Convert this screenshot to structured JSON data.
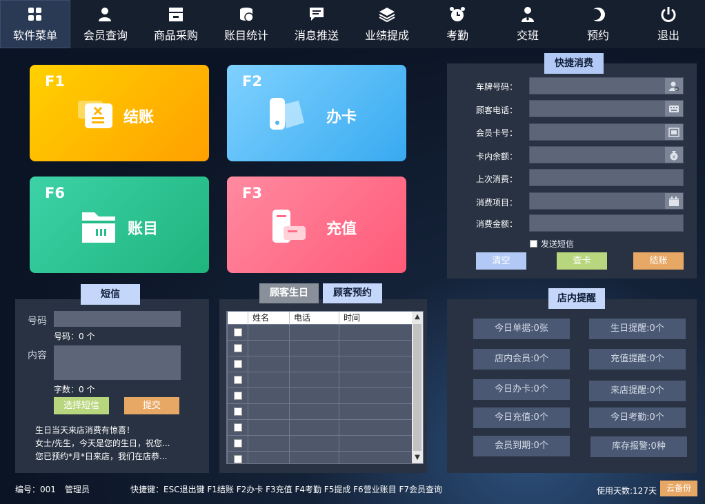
{
  "nav": [
    {
      "label": "软件菜单",
      "icon": "grid-icon"
    },
    {
      "label": "会员查询",
      "icon": "member-icon"
    },
    {
      "label": "商品采购",
      "icon": "register-icon"
    },
    {
      "label": "账目统计",
      "icon": "coins-icon"
    },
    {
      "label": "消息推送",
      "icon": "message-icon"
    },
    {
      "label": "业绩提成",
      "icon": "layers-icon"
    },
    {
      "label": "考勤",
      "icon": "alarm-clock-icon"
    },
    {
      "label": "交班",
      "icon": "staff-icon"
    },
    {
      "label": "预约",
      "icon": "moon-icon"
    },
    {
      "label": "退出",
      "icon": "power-icon"
    }
  ],
  "tiles": {
    "f1": {
      "key": "F1",
      "label": "结账"
    },
    "f2": {
      "key": "F2",
      "label": "办卡"
    },
    "f6": {
      "key": "F6",
      "label": "账目"
    },
    "f3": {
      "key": "F3",
      "label": "充值"
    }
  },
  "quick": {
    "title": "快捷消费",
    "fields": {
      "plate": "车牌号码：",
      "phone": "顾客电话：",
      "card": "会员卡号：",
      "balance": "卡内余额：",
      "last": "上次消费：",
      "item": "消费项目：",
      "amount": "消费金额："
    },
    "sms_checkbox": "发送短信",
    "clear": "清空",
    "check_card": "查卡",
    "checkout": "结账"
  },
  "sms": {
    "title": "短信",
    "number_label": "号码",
    "number_count": "号码：0 个",
    "content_label": "内容",
    "char_count": "字数：0 个",
    "select": "选择短信",
    "submit": "提交",
    "messages": [
      "生日当天来店消费有惊喜！",
      "女士/先生，今天是您的生日，祝您...",
      "您已预约*月*日来店，我们在店恭..."
    ]
  },
  "customer": {
    "tab_birthday": "顾客生日",
    "tab_booking": "顾客预约",
    "columns": [
      "姓名",
      "电话",
      "时间"
    ],
    "rows": 9
  },
  "reminder": {
    "title": "店内提醒",
    "items": [
      "今日单据:0张",
      "生日提醒:0个",
      "店内会员:0个",
      "充值提醒:0个",
      "今日办卡:0个",
      "来店提醒:0个",
      "今日充值:0个",
      "今日考勤:0个",
      "会员到期:0个",
      "库存报警:0种"
    ]
  },
  "status": {
    "id": "编号：001",
    "role": "管理员",
    "shortcuts": "快捷键：ESC退出键 F1结账 F2办卡 F3充值 F4考勤 F5提成 F6营业账目 F7会员查询",
    "days": "使用天数:127天",
    "backup": "云备份"
  },
  "colors": {
    "accent": "#b3c9f5",
    "f1": "#ffb400",
    "f2": "#4db6f5",
    "f6": "#25bc88",
    "f3": "#ff6a86",
    "green_btn": "#b8d67e",
    "orange_btn": "#e8a865"
  }
}
